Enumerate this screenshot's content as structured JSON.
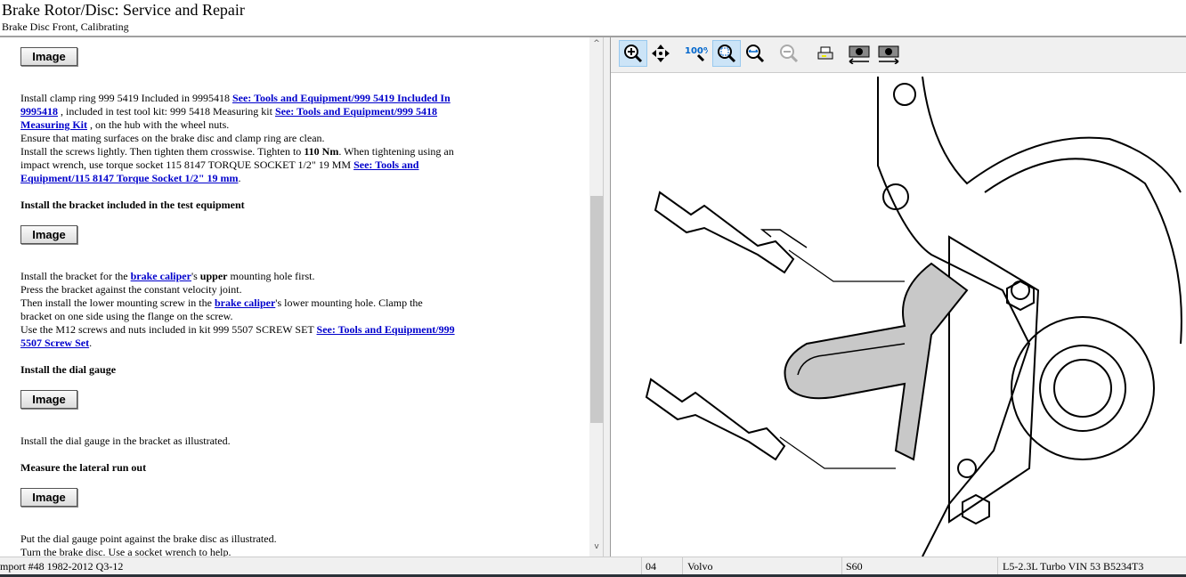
{
  "header": {
    "title": "Brake Rotor/Disc:  Service and Repair",
    "subtitle": "Brake Disc Front, Calibrating"
  },
  "content": {
    "image_label": "Image",
    "p1": {
      "t1": "Install clamp ring 999 5419 Included in 9995418 ",
      "l1": "See: Tools and Equipment/999 5419 Included In 9995418",
      "t2": " , included in test tool kit: 999 5418 Measuring kit ",
      "l2": "See: Tools and Equipment/999 5418 Measuring Kit",
      "t3": " , on the hub with the wheel nuts.",
      "line2": "Ensure that mating surfaces on the brake disc and clamp ring are clean.",
      "t4": "Install the screws lightly. Then tighten them crosswise. Tighten to ",
      "b1": "110 Nm",
      "t5": ". When tightening using an impact wrench, use torque socket 115 8147 TORQUE SOCKET 1/2\" 19 MM  ",
      "l3": "See: Tools and Equipment/115 8147 Torque Socket 1/2\" 19 mm",
      "t6": "."
    },
    "h1": "Install the bracket included in the test equipment",
    "p2": {
      "t1": "Install the bracket for the ",
      "l1": "brake caliper",
      "t2": "'s ",
      "b1": "upper",
      "t3": " mounting hole first.",
      "line2": "Press the bracket against the constant velocity joint.",
      "t4": "Then install the lower mounting screw in the ",
      "l2": "brake caliper",
      "t5": "'s lower mounting hole. Clamp the bracket on one side using the flange on the screw.",
      "t6": "Use the M12 screws and nuts included in kit 999 5507 SCREW SET  ",
      "l3": "See: Tools and Equipment/999 5507 Screw Set",
      "t7": "."
    },
    "h2": "Install the dial gauge",
    "p3": "Install the dial gauge in the bracket as illustrated.",
    "h3": "Measure the lateral run out",
    "p4a": "Put the dial gauge point against the brake disc as illustrated.",
    "p4b": "Turn the brake disc. Use a socket wrench to help."
  },
  "toolbar": [
    "zoom-in",
    "pan",
    "zoom-100",
    "zoom-fit",
    "zoom-width",
    "zoom-out",
    "print",
    "previous-image",
    "next-image"
  ],
  "status": {
    "source": "mport #48 1982-2012 Q3-12",
    "year": "04",
    "make": "Volvo",
    "model": "S60",
    "engine": "L5-2.3L Turbo VIN 53 B5234T3"
  }
}
